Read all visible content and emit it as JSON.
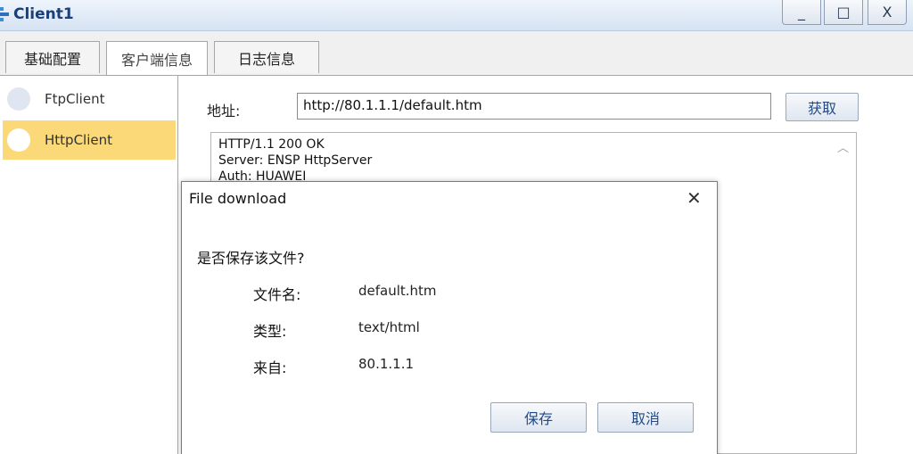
{
  "window": {
    "title": "Client1",
    "minimize": "_",
    "maximize": "□",
    "close": "X"
  },
  "tabs": [
    {
      "label": "基础配置"
    },
    {
      "label": "客户端信息"
    },
    {
      "label": "日志信息"
    }
  ],
  "sidebar": {
    "items": [
      {
        "label": "FtpClient"
      },
      {
        "label": "HttpClient"
      }
    ]
  },
  "main": {
    "address_label": "地址:",
    "address_value": "http://80.1.1.1/default.htm",
    "fetch_label": "获取",
    "response_lines": [
      "HTTP/1.1 200 OK",
      "Server: ENSP HttpServer",
      "Auth: HUAWEI"
    ]
  },
  "dialog": {
    "title": "File download",
    "close": "✕",
    "question": "是否保存该文件?",
    "filename_label": "文件名:",
    "filename_value": "default.htm",
    "type_label": "类型:",
    "type_value": "text/html",
    "from_label": "来自:",
    "from_value": "80.1.1.1",
    "save_label": "保存",
    "cancel_label": "取消"
  },
  "colors": {
    "selected_item": "#fbd978",
    "title_text": "#1a3f7a",
    "button_text": "#234a86"
  }
}
